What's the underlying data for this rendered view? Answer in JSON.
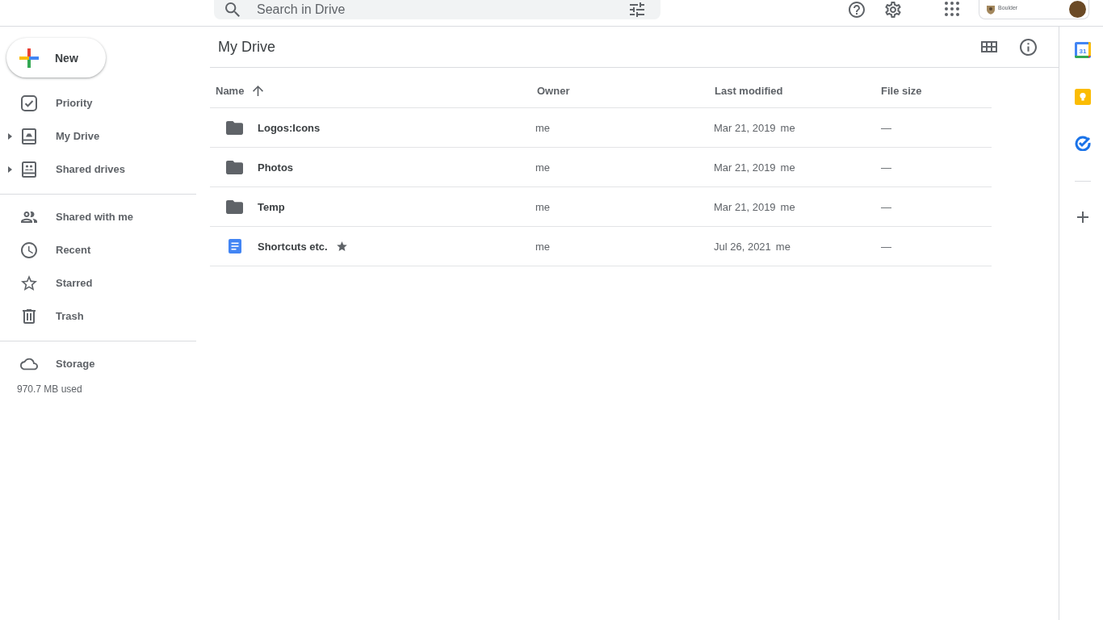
{
  "top_bar": {
    "search": {
      "placeholder": "Search in Drive"
    },
    "account": {
      "org_text": "Boulder"
    }
  },
  "sidebar": {
    "new_button": "New",
    "groups": [
      {
        "items": [
          {
            "label": "Priority",
            "selected": false
          },
          {
            "label": "My Drive",
            "selected": false,
            "expanded": false
          },
          {
            "label": "Shared drives",
            "selected": false,
            "expanded": false
          }
        ]
      },
      {
        "items": [
          {
            "label": "Shared with me",
            "selected": false
          },
          {
            "label": "Recent",
            "selected": false
          },
          {
            "label": "Starred",
            "selected": false
          },
          {
            "label": "Trash",
            "selected": false
          }
        ]
      }
    ],
    "storage": {
      "label": "Storage",
      "selected": false,
      "usage": "970.7 MB used"
    }
  },
  "main": {
    "title": "My Drive",
    "table": {
      "columns": [
        {
          "label": "Name",
          "sorted": true
        },
        {
          "label": "Owner",
          "sorted": false
        },
        {
          "label": "Last modified",
          "sorted": false
        },
        {
          "label": "File size",
          "sorted": false
        }
      ],
      "rows": [
        {
          "kind": "folder",
          "name": "Logos:Icons",
          "starred": false,
          "owner": "me",
          "modified": "Mar 21, 2019",
          "modified_by": "me",
          "size": "—"
        },
        {
          "kind": "folder",
          "name": "Photos",
          "starred": false,
          "owner": "me",
          "modified": "Mar 21, 2019",
          "modified_by": "me",
          "size": "—"
        },
        {
          "kind": "folder",
          "name": "Temp",
          "starred": false,
          "owner": "me",
          "modified": "Mar 21, 2019",
          "modified_by": "me",
          "size": "—"
        },
        {
          "kind": "document",
          "name": "Shortcuts etc.",
          "starred": true,
          "owner": "me",
          "modified": "Jul 26, 2021",
          "modified_by": "me",
          "size": "—"
        }
      ]
    }
  },
  "side_panel": {
    "calendar_day": "31"
  }
}
